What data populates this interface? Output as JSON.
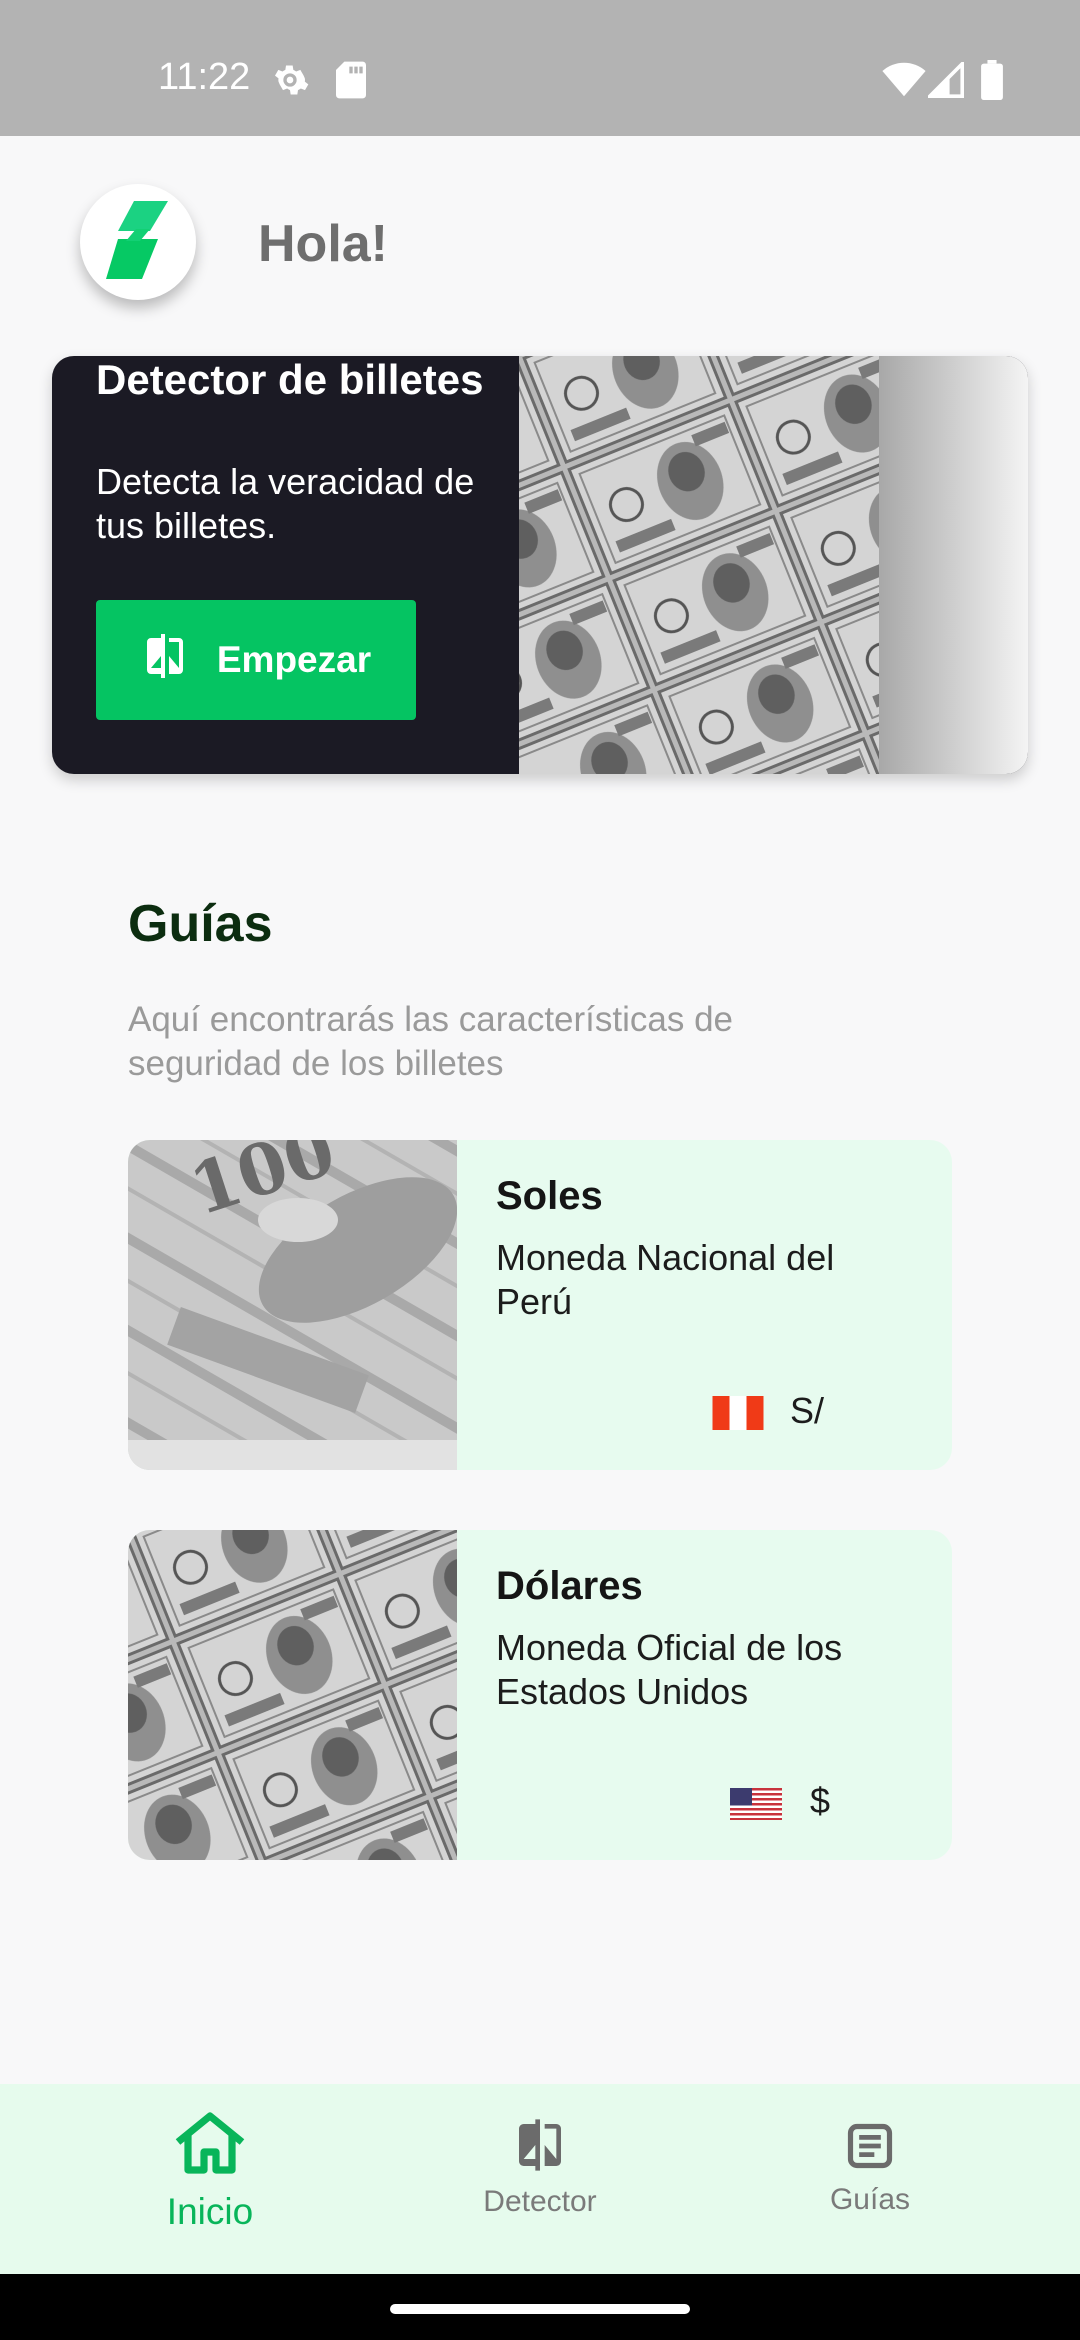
{
  "status_bar": {
    "time": "11:22",
    "icons": [
      "settings-gear-icon",
      "sd-card-icon",
      "wifi-icon",
      "cell-signal-icon",
      "battery-icon"
    ]
  },
  "header": {
    "logo_icon": "lightning-bolt-icon",
    "greeting": "Hola!"
  },
  "hero": {
    "title": "Detector de billetes",
    "description": "Detecta la veracidad de tus billetes.",
    "button_label": "Empezar",
    "button_icon": "compare-icon",
    "image": "dollar-bills-photo"
  },
  "guides": {
    "title": "Guías",
    "subtitle": "Aquí encontrarás las características de seguridad de los billetes",
    "cards": [
      {
        "title": "Soles",
        "description": "Moneda Nacional del Perú",
        "flag": "peru-flag-icon",
        "symbol": "S/",
        "image": "soles-bill-photo"
      },
      {
        "title": "Dólares",
        "description": "Moneda Oficial de los Estados Unidos",
        "flag": "usa-flag-icon",
        "symbol": "$",
        "image": "dollar-bills-photo"
      }
    ]
  },
  "bottom_nav": {
    "items": [
      {
        "label": "Inicio",
        "icon": "home-icon",
        "active": true
      },
      {
        "label": "Detector",
        "icon": "compare-icon",
        "active": false
      },
      {
        "label": "Guías",
        "icon": "document-icon",
        "active": false
      }
    ]
  },
  "colors": {
    "accent_green": "#05c462",
    "nav_active": "#08b55a",
    "hero_bg": "#1b1a24",
    "card_bg": "#e7fbef",
    "nav_bg": "#e6fbed",
    "status_bar_bg": "#b3b3b3"
  }
}
